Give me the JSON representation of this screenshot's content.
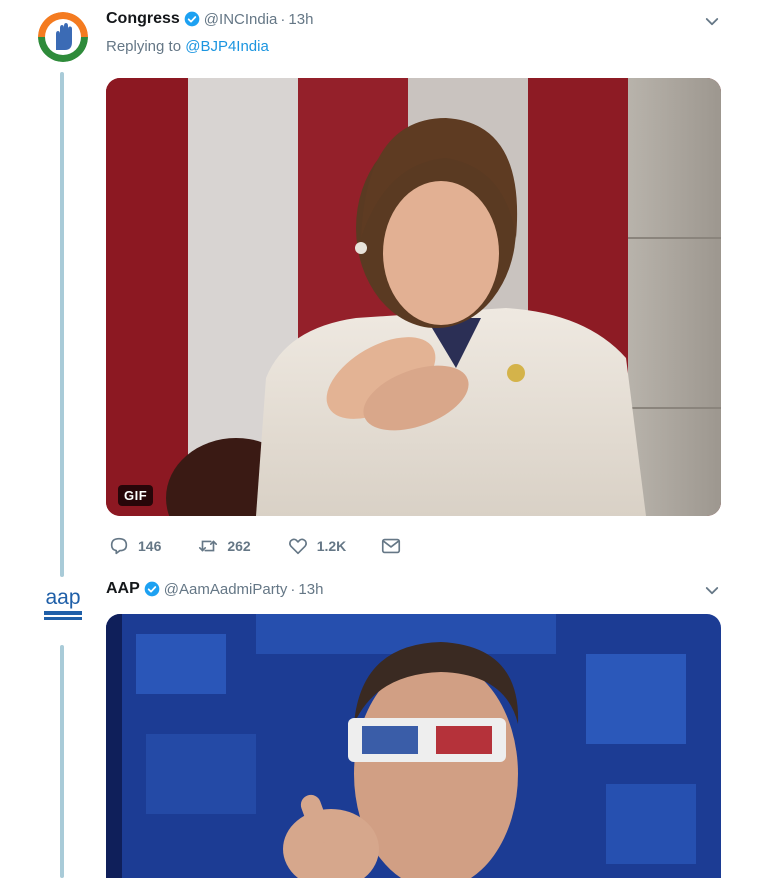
{
  "tweets": [
    {
      "name": "Congress",
      "handle": "@INCIndia",
      "separator": "·",
      "time": "13h",
      "replying_prefix": "Replying to",
      "replying_to": "@BJP4India",
      "media_badge": "GIF",
      "actions": {
        "replies": "146",
        "retweets": "262",
        "likes": "1.2K"
      },
      "avatar_icon": "congress-hand-logo-icon"
    },
    {
      "name": "AAP",
      "handle": "@AamAadmiParty",
      "separator": "·",
      "time": "13h",
      "avatar_text": "aap",
      "avatar_icon": "aap-logo-icon"
    }
  ],
  "colors": {
    "verified": "#1da1f2",
    "link": "#1b95e0",
    "muted": "#657786",
    "thread_line": "#a9cbd8"
  }
}
